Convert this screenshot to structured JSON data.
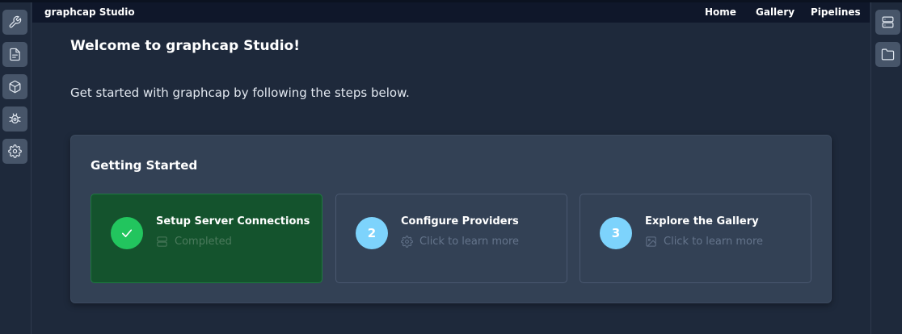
{
  "header": {
    "brand": "graphcap Studio",
    "nav": [
      "Home",
      "Gallery",
      "Pipelines"
    ]
  },
  "left_sidebar": {
    "icons": [
      "wrench-icon",
      "document-icon",
      "cube-icon",
      "bug-settings-icon",
      "gear-icon"
    ]
  },
  "right_sidebar": {
    "icons": [
      "server-icon",
      "folder-icon"
    ]
  },
  "main": {
    "title": "Welcome to graphcap Studio!",
    "subtitle": "Get started with graphcap by following the steps below."
  },
  "getting_started": {
    "title": "Getting Started",
    "steps": [
      {
        "badge": "",
        "title": "Setup Server Connections",
        "status": "Completed",
        "icon": "server-icon",
        "state": "completed"
      },
      {
        "badge": "2",
        "title": "Configure Providers",
        "status": "Click to learn more",
        "icon": "gear-icon",
        "state": "pending"
      },
      {
        "badge": "3",
        "title": "Explore the Gallery",
        "status": "Click to learn more",
        "icon": "image-icon",
        "state": "pending"
      }
    ]
  },
  "colors": {
    "background": "#1e293b",
    "header": "#0f172a",
    "card": "#334155",
    "completed_step": "#14532d",
    "completed_badge": "#22c55e",
    "pending_badge": "#7dd3fc"
  }
}
